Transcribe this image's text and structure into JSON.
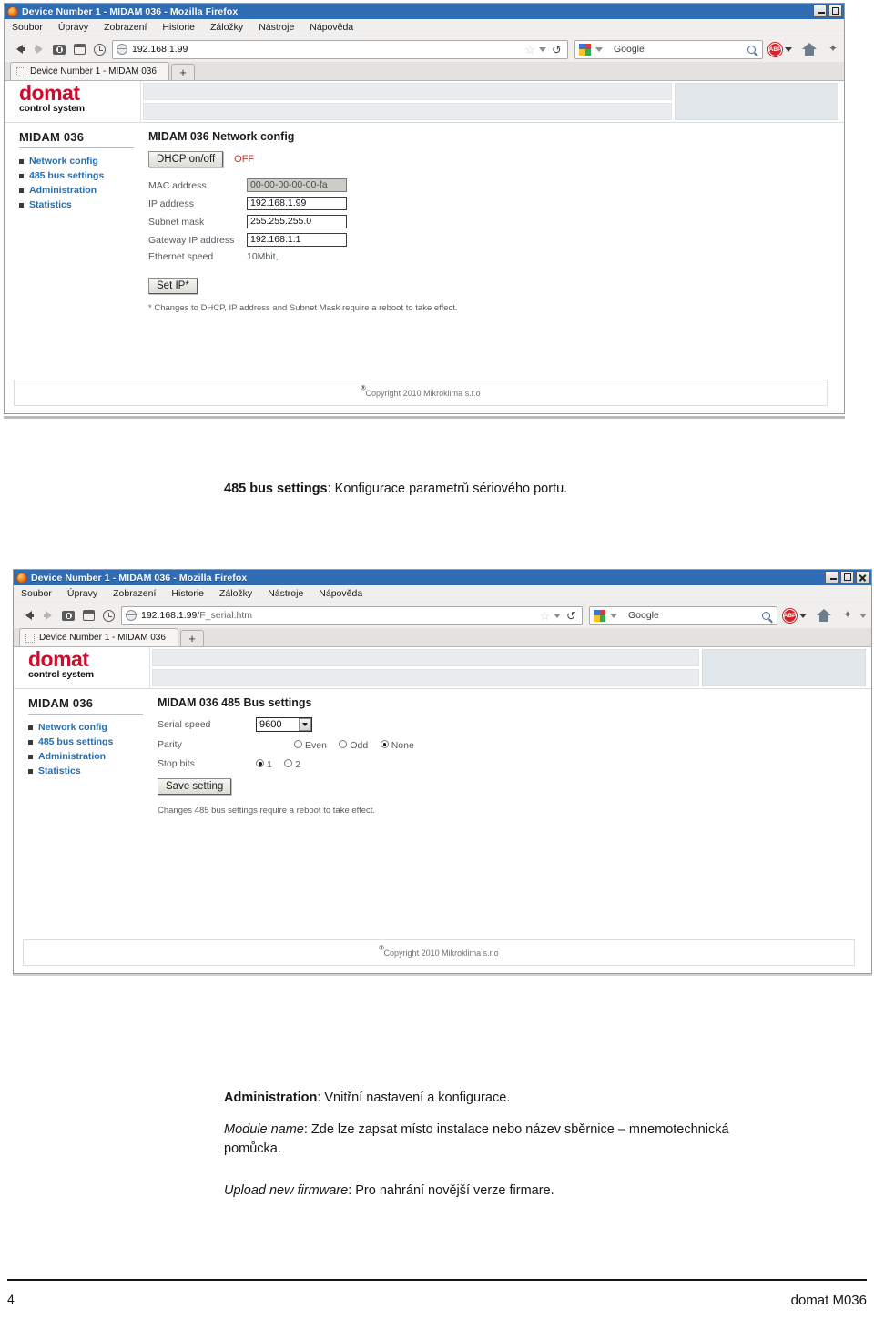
{
  "document": {
    "page_number": "4",
    "doc_label": "domat M036",
    "paragraphs": [
      {
        "id": "p-485",
        "bold": "485 bus settings",
        "rest": ": Konfigurace parametrů sériového portu."
      },
      {
        "id": "p-admin",
        "bold": "Administration",
        "rest": ": Vnitřní nastavení a konfigurace."
      },
      {
        "id": "p-module",
        "italic": "Module name",
        "rest": ": Zde lze zapsat místo instalace nebo název sběrnice – mnemotechnická pomůcka."
      },
      {
        "id": "p-upload",
        "italic": "Upload new firmware",
        "rest": ": Pro nahrání novější verze firmare."
      }
    ]
  },
  "browser": {
    "window_title": "Device Number 1 - MIDAM 036 - Mozilla Firefox",
    "menu": [
      "Soubor",
      "Úpravy",
      "Zobrazení",
      "Historie",
      "Záložky",
      "Nástroje",
      "Nápověda"
    ],
    "menu_underline": [
      "S",
      "a",
      "Z",
      "H",
      "o",
      "N",
      "ě"
    ],
    "tab_title": "Device Number 1 - MIDAM 036",
    "new_tab_label": "+",
    "search_engine": "Google",
    "abp_label": "ABP",
    "window_controls": {
      "minimize": "_",
      "maximize": "□",
      "close": "×"
    },
    "icons": {
      "back": "back-arrow-icon",
      "forward": "forward-arrow-icon",
      "download": "download-icon",
      "window": "window-icon",
      "history": "history-clock-icon",
      "globe": "globe-icon",
      "bookmark_star": "star-icon",
      "reload": "reload-icon",
      "search": "search-icon",
      "home": "home-icon"
    }
  },
  "window1": {
    "url_main": "192.168.1.99",
    "url_path": ""
  },
  "window2": {
    "url_main": "192.168.1.99",
    "url_path": "/F_serial.htm"
  },
  "site": {
    "logo_main": "domat",
    "logo_sub": "control system",
    "sidebar_title": "MIDAM 036",
    "sidebar_items": [
      {
        "label": "Network config"
      },
      {
        "label": "485 bus settings"
      },
      {
        "label": "Administration"
      },
      {
        "label": "Statistics"
      }
    ],
    "copyright": "Copyright 2010 Mikroklima s.r.o",
    "copyright_mark": "®"
  },
  "network_page": {
    "title": "MIDAM 036 Network config",
    "dhcp_button": "DHCP on/off",
    "dhcp_state": "OFF",
    "fields": [
      {
        "label": "MAC address",
        "value": "00-00-00-00-00-fa",
        "readonly": true
      },
      {
        "label": "IP address",
        "value": "192.168.1.99",
        "readonly": false
      },
      {
        "label": "Subnet mask",
        "value": "255.255.255.0",
        "readonly": false
      },
      {
        "label": "Gateway IP address",
        "value": "192.168.1.1",
        "readonly": false
      }
    ],
    "ethernet_speed_label": "Ethernet speed",
    "ethernet_speed_value": "10Mbit,",
    "set_ip_button": "Set IP*",
    "note": "* Changes to DHCP, IP address and Subnet Mask require a reboot to take effect."
  },
  "serial_page": {
    "title": "MIDAM 036 485 Bus settings",
    "serial_speed_label": "Serial speed",
    "serial_speed_value": "9600",
    "parity_label": "Parity",
    "parity_options": [
      {
        "label": "Even",
        "selected": false
      },
      {
        "label": "Odd",
        "selected": false
      },
      {
        "label": "None",
        "selected": true
      }
    ],
    "stop_bits_label": "Stop bits",
    "stop_bits_options": [
      {
        "label": "1",
        "selected": true
      },
      {
        "label": "2",
        "selected": false
      }
    ],
    "save_button": "Save setting",
    "note": "Changes 485 bus settings require a reboot to take effect."
  },
  "colors": {
    "logo_red": "#c8102e",
    "link_blue": "#1f6fb8",
    "titlebar_blue": "#2f6cb4",
    "dhcp_off_red": "#c0392b"
  }
}
